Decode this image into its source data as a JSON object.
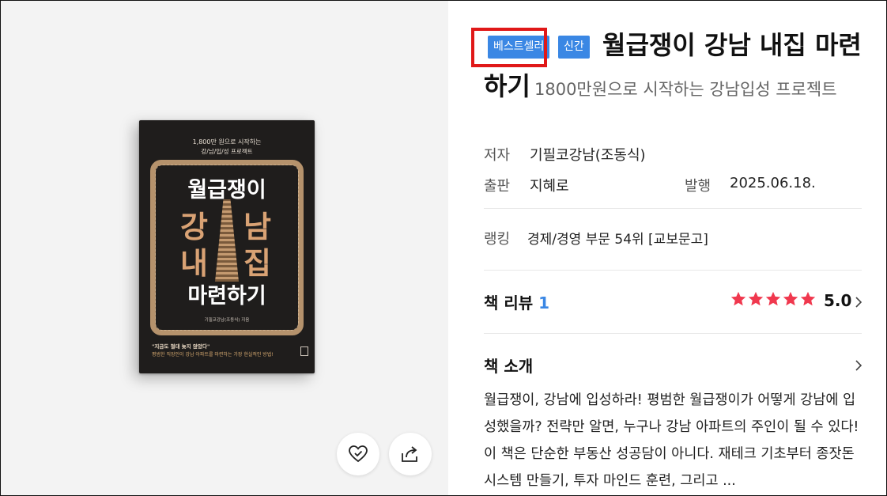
{
  "cover": {
    "top_line1": "1,800만 원으로 시작하는",
    "top_line2": "강/남/입/성 프로젝트",
    "title_line1": "월급쟁이",
    "title_big_left1": "강",
    "title_big_right1": "남",
    "title_big_left2": "내",
    "title_big_right2": "집",
    "title_line4": "마련하기",
    "author": "기필코강남(조동식) 지음",
    "quote": "\"지금도 절대 늦지 않았다\"",
    "sub": "평범한 직장인이 강남 아파트를 마련하는 가장 현실적인 방법!"
  },
  "badges": {
    "best": "베스트셀러",
    "new": "신간"
  },
  "book": {
    "title": "월급쟁이 강남 내집 마련하기",
    "subtitle": "1800만원으로 시작하는 강남입성 프로젝트"
  },
  "meta": {
    "author_label": "저자",
    "author_value": "기필코강남(조동식)",
    "publisher_label": "출판",
    "publisher_value": "지혜로",
    "date_label": "발행",
    "date_value": "2025.06.18.",
    "ranking_label": "랭킹",
    "ranking_value": "경제/경영 부문 54위 [교보문고]"
  },
  "review": {
    "label": "책 리뷰",
    "count": "1",
    "rating": "5.0",
    "stars": 5
  },
  "intro": {
    "label": "책 소개",
    "text": "월급쟁이, 강남에 입성하라! 평범한 월급쟁이가 어떻게 강남에 입성했을까? 전략만 알면, 누구나 강남 아파트의 주인이 될 수 있다! 이 책은 단순한 부동산 성공담이 아니다. 재테크 기초부터 종잣돈 시스템 만들기, 투자 마인드 훈련, 그리고 ..."
  },
  "colors": {
    "accent": "#3a87e4",
    "star": "#f0384e",
    "highlight": "#e01818"
  },
  "icons": {
    "wish": "heart-check-icon",
    "share": "share-icon",
    "chevron": "chevron-right-icon"
  }
}
